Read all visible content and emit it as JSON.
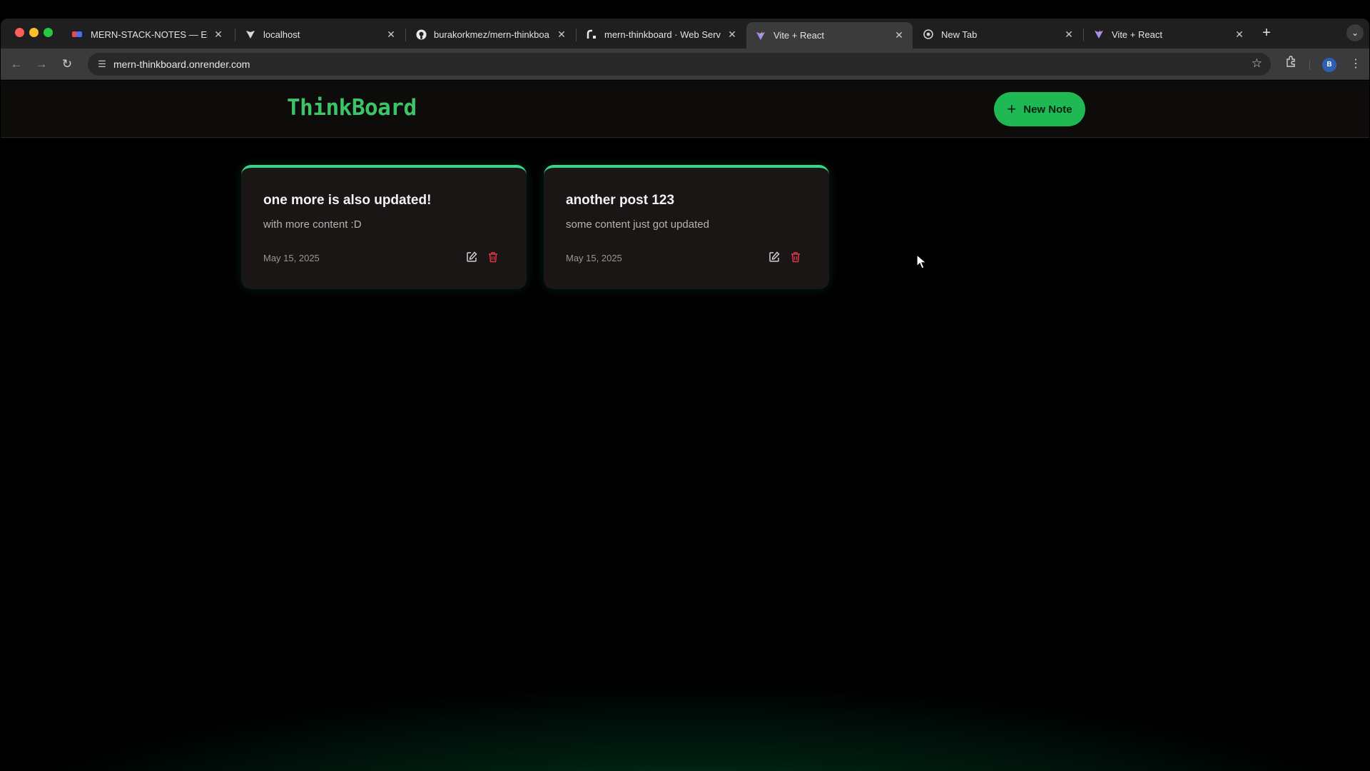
{
  "browser": {
    "tabs": [
      {
        "title": "MERN-STACK-NOTES — Eras",
        "icon": "app-icon",
        "active": false
      },
      {
        "title": "localhost",
        "icon": "vite-icon",
        "active": false
      },
      {
        "title": "burakorkmez/mern-thinkboa",
        "icon": "github-icon",
        "active": false
      },
      {
        "title": "mern-thinkboard · Web Serv",
        "icon": "render-icon",
        "active": false
      },
      {
        "title": "Vite + React",
        "icon": "vite-icon",
        "active": true
      },
      {
        "title": "New Tab",
        "icon": "chrome-icon",
        "active": false
      },
      {
        "title": "Vite + React",
        "icon": "vite-icon",
        "active": false
      }
    ],
    "url": "mern-thinkboard.onrender.com",
    "profile_initial": "B"
  },
  "app": {
    "brand": "ThinkBoard",
    "new_note_label": "New Note",
    "colors": {
      "accent": "#1fb954",
      "brand": "#3cc466",
      "card_border": "#36d68a",
      "delete": "#e0374a"
    }
  },
  "notes": [
    {
      "title": "one more is also updated!",
      "content": "with more content :D",
      "date": "May 15, 2025"
    },
    {
      "title": "another post 123",
      "content": "some content just got updated",
      "date": "May 15, 2025"
    }
  ]
}
